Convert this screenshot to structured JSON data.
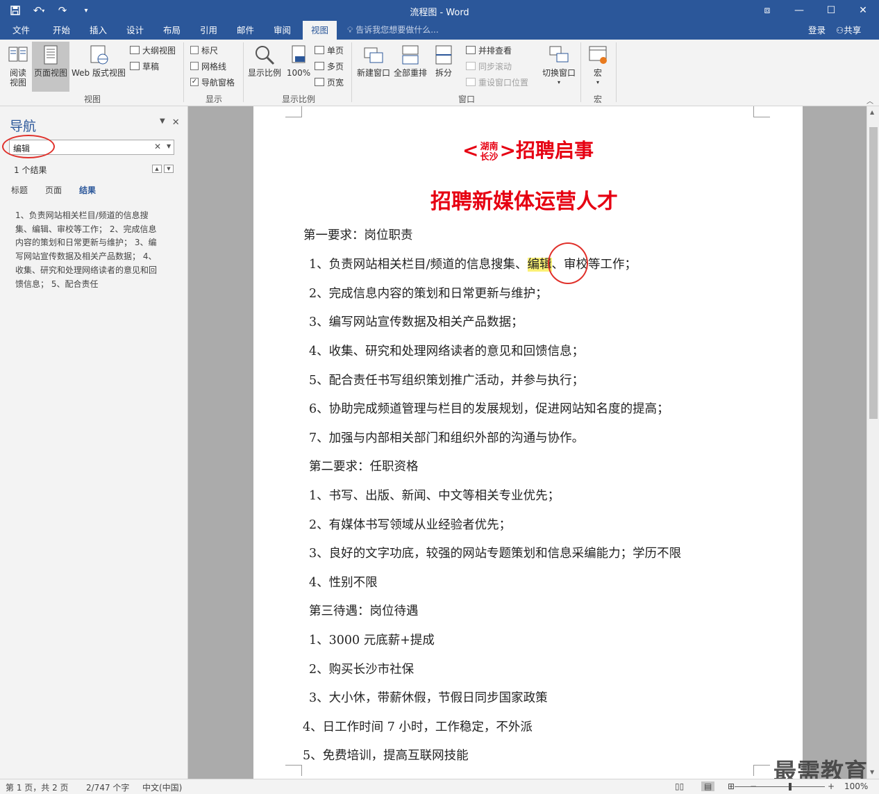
{
  "window": {
    "title": "流程图 - Word"
  },
  "qat": {
    "save_icon": "save-icon",
    "undo_icon": "undo-icon",
    "redo_icon": "redo-icon",
    "customize_icon": "customize-icon"
  },
  "tabs": [
    {
      "label": "文件"
    },
    {
      "label": "开始"
    },
    {
      "label": "插入"
    },
    {
      "label": "设计"
    },
    {
      "label": "布局"
    },
    {
      "label": "引用"
    },
    {
      "label": "邮件"
    },
    {
      "label": "审阅"
    },
    {
      "label": "视图"
    }
  ],
  "tellme": {
    "text": "告诉我您想要做什么..."
  },
  "account": {
    "login": "登录",
    "share": "共享"
  },
  "ribbon": {
    "views": {
      "read": "阅读\n视图",
      "print": "页面视图",
      "web": "Web 版式视图",
      "outline": "大纲视图",
      "draft": "草稿",
      "group": "视图"
    },
    "show": {
      "ruler": "标尺",
      "gridlines": "网格线",
      "navpane": "导航窗格",
      "group": "显示"
    },
    "zoom": {
      "zoom": "显示比例",
      "hundred": "100%",
      "one": "单页",
      "multi": "多页",
      "width": "页宽",
      "group": "显示比例"
    },
    "window": {
      "newwin": "新建窗口",
      "arrange": "全部重排",
      "split": "拆分",
      "side": "并排查看",
      "sync": "同步滚动",
      "reset": "重设窗口位置",
      "switch": "切换窗口",
      "group": "窗口"
    },
    "macros": {
      "macro": "宏",
      "group": "宏"
    }
  },
  "nav": {
    "title": "导航",
    "search_value": "编辑",
    "result_count": "1 个结果",
    "tabs": {
      "headings": "标题",
      "pages": "页面",
      "results": "结果"
    },
    "snippet": "1、负责网站相关栏目/频道的信息搜集、编辑、审校等工作； 2、完成信息内容的策划和日常更新与维护； 3、编写网站宣传数据及相关产品数据； 4、收集、研究和处理网络读者的意见和回馈信息； 5、配合责任"
  },
  "doc": {
    "title_lt": "<",
    "title_top": "湖南",
    "title_bot": "长沙",
    "title_gt": ">",
    "title_main": "招聘启事",
    "subtitle": "招聘新媒体运营人才",
    "h1": "第一要求：岗位职责",
    "l1_pre": "1、负责网站相关栏目/频道的信息搜集、",
    "l1_hl": "编辑",
    "l1_post": "、审校等工作；",
    "l2": "2、完成信息内容的策划和日常更新与维护；",
    "l3": "3、编写网站宣传数据及相关产品数据；",
    "l4": "4、收集、研究和处理网络读者的意见和回馈信息；",
    "l5": "5、配合责任书写组织策划推广活动，并参与执行；",
    "l6": "6、协助完成频道管理与栏目的发展规划，促进网站知名度的提高；",
    "l7": "7、加强与内部相关部门和组织外部的沟通与协作。",
    "h2": "第二要求：任职资格",
    "m1": "1、书写、出版、新闻、中文等相关专业优先；",
    "m2": "2、有媒体书写领域从业经验者优先；",
    "m3": "3、良好的文字功底，较强的网站专题策划和信息采编能力；学历不限",
    "m4": "4、性别不限",
    "h3": "第三待遇：岗位待遇",
    "n1": "1、3000 元底薪+提成",
    "n2": "2、购买长沙市社保",
    "n3": "3、大小休，带薪休假，节假日同步国家政策",
    "n4": "4、日工作时间 7 小时，工作稳定，不外派",
    "n5": "5、免费培训，提高互联网技能"
  },
  "watermark": "最需教育",
  "status": {
    "page": "第 1 页，共 2 页",
    "words": "2/747 个字",
    "lang": "中文(中国)",
    "zoom": "100%"
  }
}
